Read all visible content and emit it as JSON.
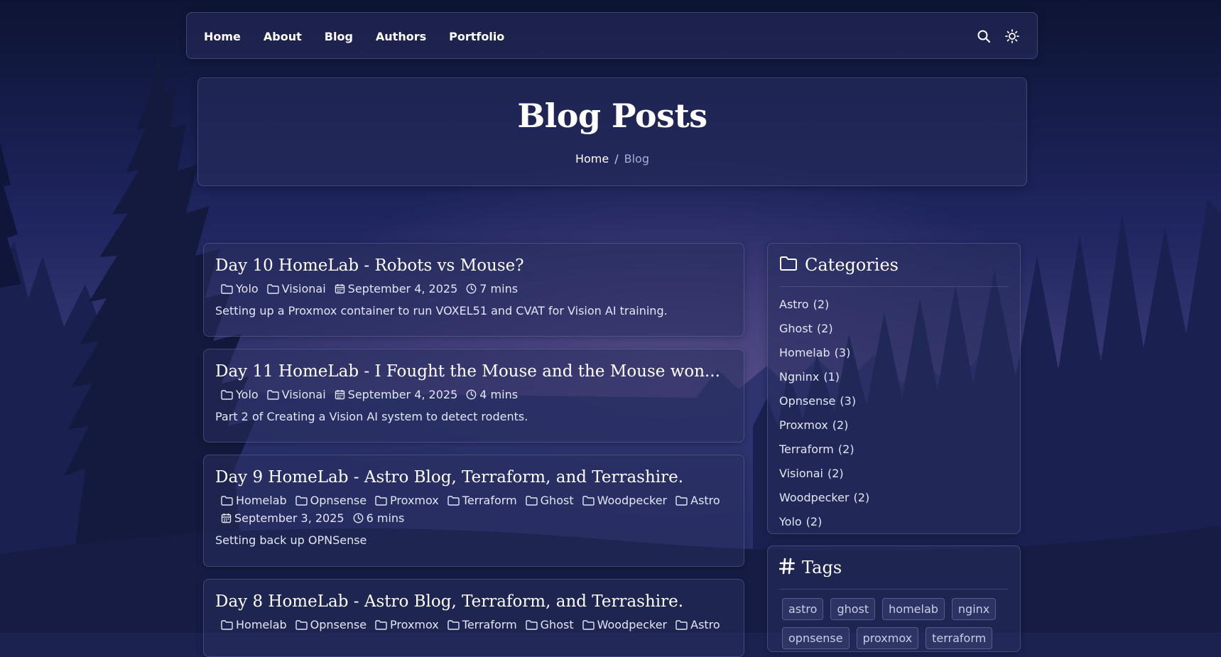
{
  "nav": {
    "items": [
      "Home",
      "About",
      "Blog",
      "Authors",
      "Portfolio"
    ],
    "icons": [
      "search-icon",
      "sun-icon"
    ]
  },
  "header": {
    "title": "Blog Posts",
    "breadcrumb": {
      "home": "Home",
      "separator": "/",
      "current": "Blog"
    }
  },
  "posts": [
    {
      "title": "Day 10 HomeLab - Robots vs Mouse?",
      "categories": [
        "Yolo",
        "Visionai"
      ],
      "date": "September 4, 2025",
      "read_time": "7 mins",
      "excerpt": "Setting up a Proxmox container to run VOXEL51 and CVAT for Vision AI training."
    },
    {
      "title": "Day 11 HomeLab - I Fought the Mouse and the Mouse won...",
      "categories": [
        "Yolo",
        "Visionai"
      ],
      "date": "September 4, 2025",
      "read_time": "4 mins",
      "excerpt": "Part 2 of Creating a Vision AI system to detect rodents."
    },
    {
      "title": "Day 9 HomeLab - Astro Blog, Terraform, and Terrashire.",
      "categories": [
        "Homelab",
        "Opnsense",
        "Proxmox",
        "Terraform",
        "Ghost",
        "Woodpecker",
        "Astro"
      ],
      "date": "September 3, 2025",
      "read_time": "6 mins",
      "excerpt": "Setting back up OPNSense"
    },
    {
      "title": "Day 8 HomeLab - Astro Blog, Terraform, and Terrashire.",
      "categories": [
        "Homelab",
        "Opnsense",
        "Proxmox",
        "Terraform",
        "Ghost",
        "Woodpecker",
        "Astro"
      ],
      "date": "",
      "read_time": "",
      "excerpt": ""
    }
  ],
  "sidebar": {
    "categories": {
      "title": "Categories",
      "items": [
        {
          "name": "Astro",
          "count": "(2)"
        },
        {
          "name": "Ghost",
          "count": "(2)"
        },
        {
          "name": "Homelab",
          "count": "(3)"
        },
        {
          "name": "Ngninx",
          "count": "(1)"
        },
        {
          "name": "Opnsense",
          "count": "(3)"
        },
        {
          "name": "Proxmox",
          "count": "(2)"
        },
        {
          "name": "Terraform",
          "count": "(2)"
        },
        {
          "name": "Visionai",
          "count": "(2)"
        },
        {
          "name": "Woodpecker",
          "count": "(2)"
        },
        {
          "name": "Yolo",
          "count": "(2)"
        }
      ]
    },
    "tags": {
      "title": "Tags",
      "items": [
        "astro",
        "ghost",
        "homelab",
        "nginx",
        "opnsense",
        "proxmox",
        "terraform"
      ]
    }
  },
  "colors": {
    "sky_top": "#0c1230",
    "sky_mid": "#242a66",
    "sky_glow": "#5b4f8a",
    "trees": "#141a3c",
    "text": "#e3e6f5"
  }
}
